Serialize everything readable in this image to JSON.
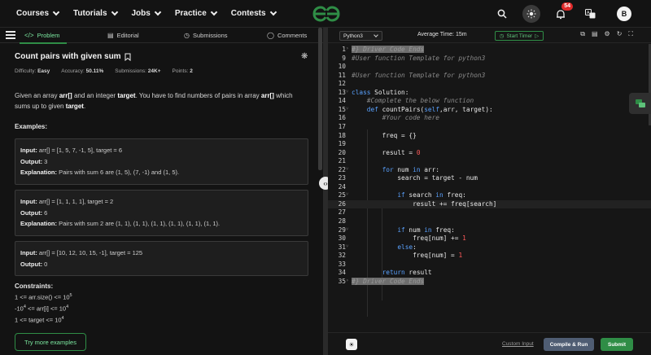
{
  "nav": {
    "items": [
      {
        "label": "Courses"
      },
      {
        "label": "Tutorials"
      },
      {
        "label": "Jobs"
      },
      {
        "label": "Practice"
      },
      {
        "label": "Contests"
      }
    ],
    "notification_count": "54",
    "avatar_letter": "B",
    "brand_color": "#2f8d46"
  },
  "left_tabs": {
    "problem": "Problem",
    "editorial": "Editorial",
    "submissions": "Submissions",
    "comments": "Comments"
  },
  "problem": {
    "title": "Count pairs with given sum",
    "difficulty_label": "Difficulty:",
    "difficulty": "Easy",
    "accuracy_label": "Accuracy:",
    "accuracy": "50.11%",
    "submissions_label": "Submissions:",
    "submissions": "24K+",
    "points_label": "Points:",
    "points": "2",
    "desc_1": "Given an array ",
    "desc_arr": "arr[]",
    "desc_2": " and an integer ",
    "desc_target": "target",
    "desc_3": ". You have to find numbers of pairs in array ",
    "desc_arr2": "arr[]",
    "desc_4": " which sums up to given ",
    "desc_target2": "target",
    "desc_5": ".",
    "examples_heading": "Examples:",
    "examples": [
      {
        "input_label": "Input:",
        "input": "arr[] = [1, 5, 7, -1, 5], target = 6",
        "output_label": "Output:",
        "output": "3",
        "explanation_label": "Explanation:",
        "explanation": "Pairs with sum 6 are (1, 5), (7, -1) and (1, 5)."
      },
      {
        "input_label": "Input:",
        "input": "arr[] = [1, 1, 1, 1], target = 2",
        "output_label": "Output:",
        "output": "6",
        "explanation_label": "Explanation:",
        "explanation": "Pairs with sum 2 are (1, 1), (1, 1), (1, 1), (1, 1), (1, 1), (1, 1)."
      },
      {
        "input_label": "Input:",
        "input": "arr[] = [10, 12, 10, 15, -1], target = 125",
        "output_label": "Output:",
        "output": "0"
      }
    ],
    "constraints_heading": "Constraints:",
    "constraints": [
      {
        "text": "1 <= arr.size() <= 10",
        "sup": "5",
        "pre": "",
        "presup": ""
      },
      {
        "text": " <= arr[i] <= 10",
        "sup": "4",
        "pre": "-10",
        "presup": "4"
      },
      {
        "text": "1 <= target <= 10",
        "sup": "4",
        "pre": "",
        "presup": ""
      }
    ],
    "try_more": "Try more examples"
  },
  "editor": {
    "language": "Python3",
    "avg_time": "Average Time: 15m",
    "start_timer": "Start Timer",
    "lines": [
      {
        "n": "1",
        "fold": "›",
        "html": "<span class='hl-gray'>#} Driver Code Ends</span>"
      },
      {
        "n": "9",
        "fold": "",
        "html": "<span class='cmt'>#User function Template for python3</span>"
      },
      {
        "n": "10",
        "fold": "",
        "html": ""
      },
      {
        "n": "11",
        "fold": "",
        "html": "<span class='cmt'>#User function Template for python3</span>"
      },
      {
        "n": "12",
        "fold": "",
        "html": ""
      },
      {
        "n": "13",
        "fold": "˅",
        "html": "<span class='kw'>class</span> Solution:"
      },
      {
        "n": "14",
        "fold": "",
        "html": "    <span class='cmt'>#Complete the below function</span>"
      },
      {
        "n": "15",
        "fold": "˅",
        "html": "    <span class='kw'>def</span> <span class='fn'>countPairs</span>(<span class='self'>self</span>,arr, target):"
      },
      {
        "n": "16",
        "fold": "",
        "html": "        <span class='cmt'>#Your code here</span>"
      },
      {
        "n": "17",
        "fold": "",
        "html": ""
      },
      {
        "n": "18",
        "fold": "",
        "html": "        freq = {}"
      },
      {
        "n": "19",
        "fold": "",
        "html": ""
      },
      {
        "n": "20",
        "fold": "",
        "html": "        result = <span class='num'>0</span>"
      },
      {
        "n": "21",
        "fold": "",
        "html": ""
      },
      {
        "n": "22",
        "fold": "˅",
        "html": "        <span class='kw'>for</span> num <span class='kw'>in</span> arr:"
      },
      {
        "n": "23",
        "fold": "",
        "html": "            search = target - num"
      },
      {
        "n": "24",
        "fold": "",
        "html": ""
      },
      {
        "n": "25",
        "fold": "˅",
        "html": "            <span class='kw'>if</span> search <span class='kw'>in</span> freq:"
      },
      {
        "n": "26",
        "fold": "",
        "html": "                result += freq[search]",
        "active": true
      },
      {
        "n": "27",
        "fold": "",
        "html": ""
      },
      {
        "n": "28",
        "fold": "",
        "html": ""
      },
      {
        "n": "29",
        "fold": "˅",
        "html": "            <span class='kw'>if</span> num <span class='kw'>in</span> freq:"
      },
      {
        "n": "30",
        "fold": "",
        "html": "                freq[num] += <span class='num'>1</span>"
      },
      {
        "n": "31",
        "fold": "˅",
        "html": "            <span class='kw'>else</span>:"
      },
      {
        "n": "32",
        "fold": "",
        "html": "                freq[num] = <span class='num'>1</span>"
      },
      {
        "n": "33",
        "fold": "",
        "html": ""
      },
      {
        "n": "34",
        "fold": "",
        "html": "        <span class='kw'>return</span> result"
      },
      {
        "n": "35",
        "fold": "›",
        "html": "<span class='hl-gray'>#} Driver Code Ends</span>"
      }
    ]
  },
  "bottom": {
    "custom_input": "Custom Input",
    "compile_run": "Compile & Run",
    "submit": "Submit"
  }
}
